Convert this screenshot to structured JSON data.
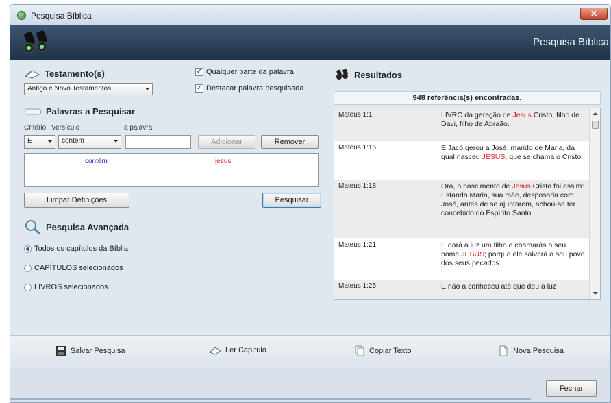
{
  "window": {
    "title": "Pesquisa Bíblica",
    "close_label": "✕",
    "banner_title": "Pesquisa Bíblica"
  },
  "testamento": {
    "title": "Testamento(s)",
    "selected": "Antigo e Novo Testamentos",
    "check_qualquer": "Qualquer parte da palavra",
    "check_destacar": "Destacar palavra pesquisada",
    "check_qualquer_on": true,
    "check_destacar_on": true
  },
  "palavras": {
    "title": "Palavras a Pesquisar",
    "label_criterio": "Critério",
    "label_versiculo": "Versículo",
    "label_palavra": "a palavra",
    "criterio_value": "E",
    "versiculo_value": "contém",
    "palavra_value": "",
    "btn_adicionar": "Adicionar",
    "btn_remover": "Remover",
    "entry_operator": "contém",
    "entry_word": "jesus",
    "btn_limpar": "Limpar Definições",
    "btn_pesquisar": "Pesquisar"
  },
  "avancada": {
    "title": "Pesquisa Avançada",
    "options": [
      {
        "label": "Todos os capítulos da Bíblia",
        "selected": true
      },
      {
        "label": "CAPÍTULOS selecionados",
        "selected": false
      },
      {
        "label": "LIVROS selecionados",
        "selected": false
      }
    ]
  },
  "resultados": {
    "title": "Resultados",
    "count": "948 referência(s) encontradas.",
    "rows": [
      {
        "ref": "Mateus 1:1",
        "before": "LIVRO da geração de ",
        "hl": "Jesus",
        "after": " Cristo, filho de Davi, filho de Abraão."
      },
      {
        "ref": "Mateus 1:16",
        "before": "E Jacó gerou a José, marido de Maria, da qual nasceu ",
        "hl": "JESUS",
        "after": ", que se chama o Cristo."
      },
      {
        "ref": "Mateus 1:18",
        "before": "Ora, o nascimento de ",
        "hl": "Jesus",
        "after": " Cristo foi assim: Estando Maria, sua mãe, desposada com José, antes de se ajuntarem, achou-se ter concebido do Espírito Santo."
      },
      {
        "ref": "Mateus 1:21",
        "before": "E dará à luz um filho e chamarás o seu nome ",
        "hl": "JESUS",
        "after": "; porque ele salvará o seu povo dos seus pecados."
      },
      {
        "ref": "Mateus 1:25",
        "before": "E não a conheceu até que deu à luz",
        "hl": "",
        "after": ""
      }
    ]
  },
  "toolbar": {
    "salvar": "Salvar Pesquisa",
    "ler": "Ler Capítulo",
    "copiar": "Copiar Texto",
    "nova": "Nova Pesquisa"
  },
  "footer": {
    "fechar": "Fechar"
  }
}
